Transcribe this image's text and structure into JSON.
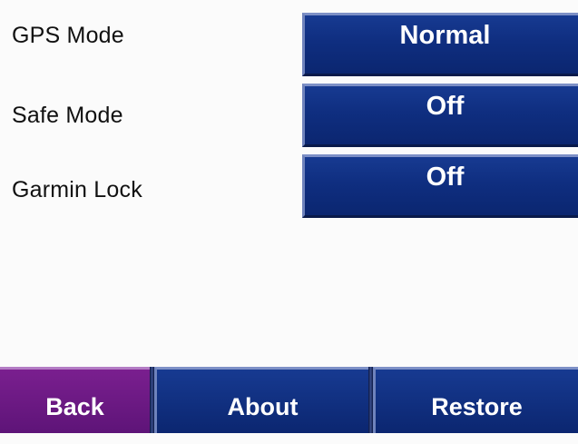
{
  "settings": {
    "rows": [
      {
        "label": "GPS Mode",
        "value": "Normal"
      },
      {
        "label": "Safe Mode",
        "value": "Off"
      },
      {
        "label": "Garmin Lock",
        "value": "Off"
      }
    ]
  },
  "nav": {
    "back_label": "Back",
    "about_label": "About",
    "restore_label": "Restore"
  },
  "colors": {
    "background": "#fbfbfb",
    "button_blue": "#0f2e80",
    "back_purple": "#6a1a82",
    "text_white": "#ffffff"
  }
}
